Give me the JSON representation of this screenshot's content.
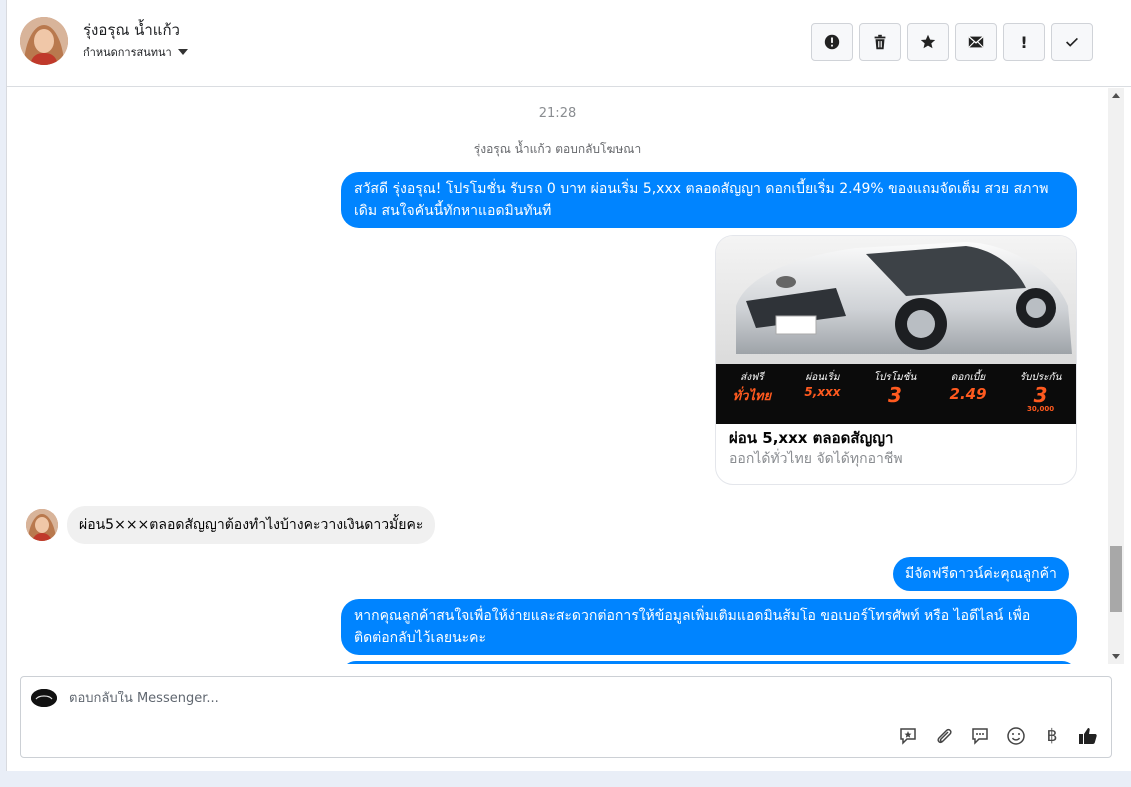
{
  "header": {
    "contact_name": "รุ่งอรุณ น้ำแก้ว",
    "status_label": "กำหนดการสนทนา",
    "actions": [
      {
        "name": "mark-spam",
        "icon": "alert-circle-icon"
      },
      {
        "name": "delete",
        "icon": "trash-icon"
      },
      {
        "name": "star",
        "icon": "star-icon"
      },
      {
        "name": "mark-unread",
        "icon": "envelope-icon"
      },
      {
        "name": "important",
        "icon": "exclamation-icon",
        "label": "!"
      },
      {
        "name": "mark-done",
        "icon": "check-icon"
      }
    ]
  },
  "thread": {
    "timestamp": "21:28",
    "reply_info": "รุ่งอรุณ น้ำแก้ว ตอบกลับโฆษณา",
    "msg_outgoing_1": "สวัสดี รุ่งอรุณ! โปรโมชั่น รับรถ 0 บาท ผ่อนเริ่ม 5,xxx ตลอดสัญญา ดอกเบี้ยเริ่ม 2.49% ของแถมจัดเต็ม สวย สภาพเดิม สนใจคันนี้ทักหาแอดมินทันที",
    "ad_card": {
      "title": "ผ่อน 5,xxx ตลอดสัญญา",
      "subtitle": "ออกได้ทั่วไทย จัดได้ทุกอาชีพ",
      "banner": {
        "ship": {
          "label": "ส่งฟรี",
          "value": "ทั่วไทย"
        },
        "installment": {
          "label": "ผ่อนเริ่ม",
          "value": "5,xxx"
        },
        "promo": {
          "label": "โปรโมชั่น",
          "value": "3"
        },
        "interest": {
          "label": "ดอกเบี้ย",
          "value": "2.49"
        },
        "insurance": {
          "label": "รับประกัน",
          "value": "3",
          "sub": "30,000"
        }
      }
    },
    "msg_incoming_1": "ผ่อน5×××ตลอดสัญญาต้องทำไงบ้างคะวางเงินดาวมั้ยคะ",
    "msg_outgoing_2": "มีจัดฟรีดาวน์ค่ะคุณลูกค้า",
    "msg_outgoing_3": "หากคุณลูกค้าสนใจเพื่อให้ง่ายและสะดวกต่อการให้ข้อมูลเพิ่มเติมแอดมินส้มโอ ขอเบอร์โทรศัพท์ หรือ ไอดีไลน์ เพื่อติดต่อกลับไว้เลยนะคะ"
  },
  "composer": {
    "placeholder": "ตอบกลับใน Messenger...",
    "tools": [
      "saved-reply-icon",
      "attach-icon",
      "chat-icon",
      "emoji-icon",
      "baht-icon",
      "like-icon"
    ],
    "baht_symbol": "฿"
  },
  "colors": {
    "outgoing_bubble": "#0084ff",
    "incoming_bubble": "#f0f0f0",
    "banner_accent": "#ff5a1f"
  }
}
